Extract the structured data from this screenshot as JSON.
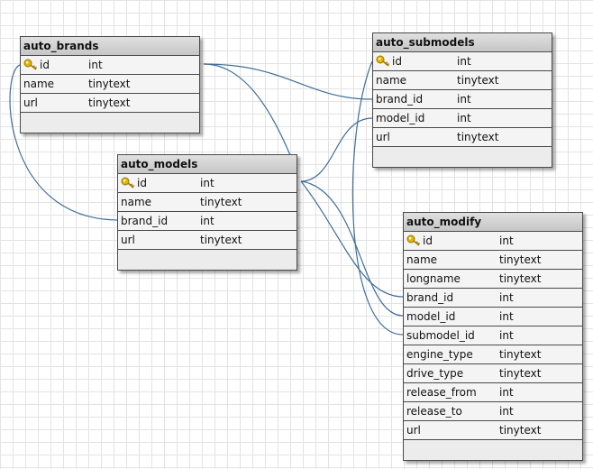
{
  "tables": {
    "auto_brands": {
      "title": "auto_brands",
      "rows": [
        {
          "name": "id",
          "type": "int"
        },
        {
          "name": "name",
          "type": "tinytext"
        },
        {
          "name": "url",
          "type": "tinytext"
        }
      ]
    },
    "auto_models": {
      "title": "auto_models",
      "rows": [
        {
          "name": "id",
          "type": "int"
        },
        {
          "name": "name",
          "type": "tinytext"
        },
        {
          "name": "brand_id",
          "type": "int"
        },
        {
          "name": "url",
          "type": "tinytext"
        }
      ]
    },
    "auto_submodels": {
      "title": "auto_submodels",
      "rows": [
        {
          "name": "id",
          "type": "int"
        },
        {
          "name": "name",
          "type": "tinytext"
        },
        {
          "name": "brand_id",
          "type": "int"
        },
        {
          "name": "model_id",
          "type": "int"
        },
        {
          "name": "url",
          "type": "tinytext"
        }
      ]
    },
    "auto_modify": {
      "title": "auto_modify",
      "rows": [
        {
          "name": "id",
          "type": "int"
        },
        {
          "name": "name",
          "type": "tinytext"
        },
        {
          "name": "longname",
          "type": "tinytext"
        },
        {
          "name": "brand_id",
          "type": "int"
        },
        {
          "name": "model_id",
          "type": "int"
        },
        {
          "name": "submodel_id",
          "type": "int"
        },
        {
          "name": "engine_type",
          "type": "tinytext"
        },
        {
          "name": "drive_type",
          "type": "tinytext"
        },
        {
          "name": "release_from",
          "type": "int"
        },
        {
          "name": "release_to",
          "type": "int"
        },
        {
          "name": "url",
          "type": "tinytext"
        }
      ]
    }
  },
  "colors": {
    "link": "#3f6e9a",
    "header": "#d2d2d2",
    "key_icon": "#e2b400"
  },
  "icons": {
    "primary_key": "key-icon"
  }
}
